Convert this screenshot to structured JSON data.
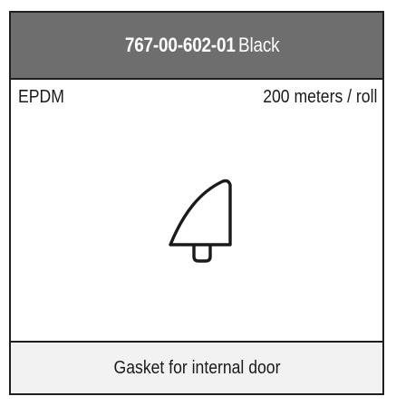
{
  "product": {
    "part_number": "767-00-602-01",
    "color": "Black",
    "material": "EPDM",
    "quantity": "200 meters / roll",
    "description": "Gasket for internal door"
  },
  "profile_icon": "gasket-profile-icon",
  "colors": {
    "header_background": "#6e6e6e",
    "header_text": "#ffffff",
    "border": "#1f1f1f",
    "footer_background": "#f2f2f2"
  }
}
